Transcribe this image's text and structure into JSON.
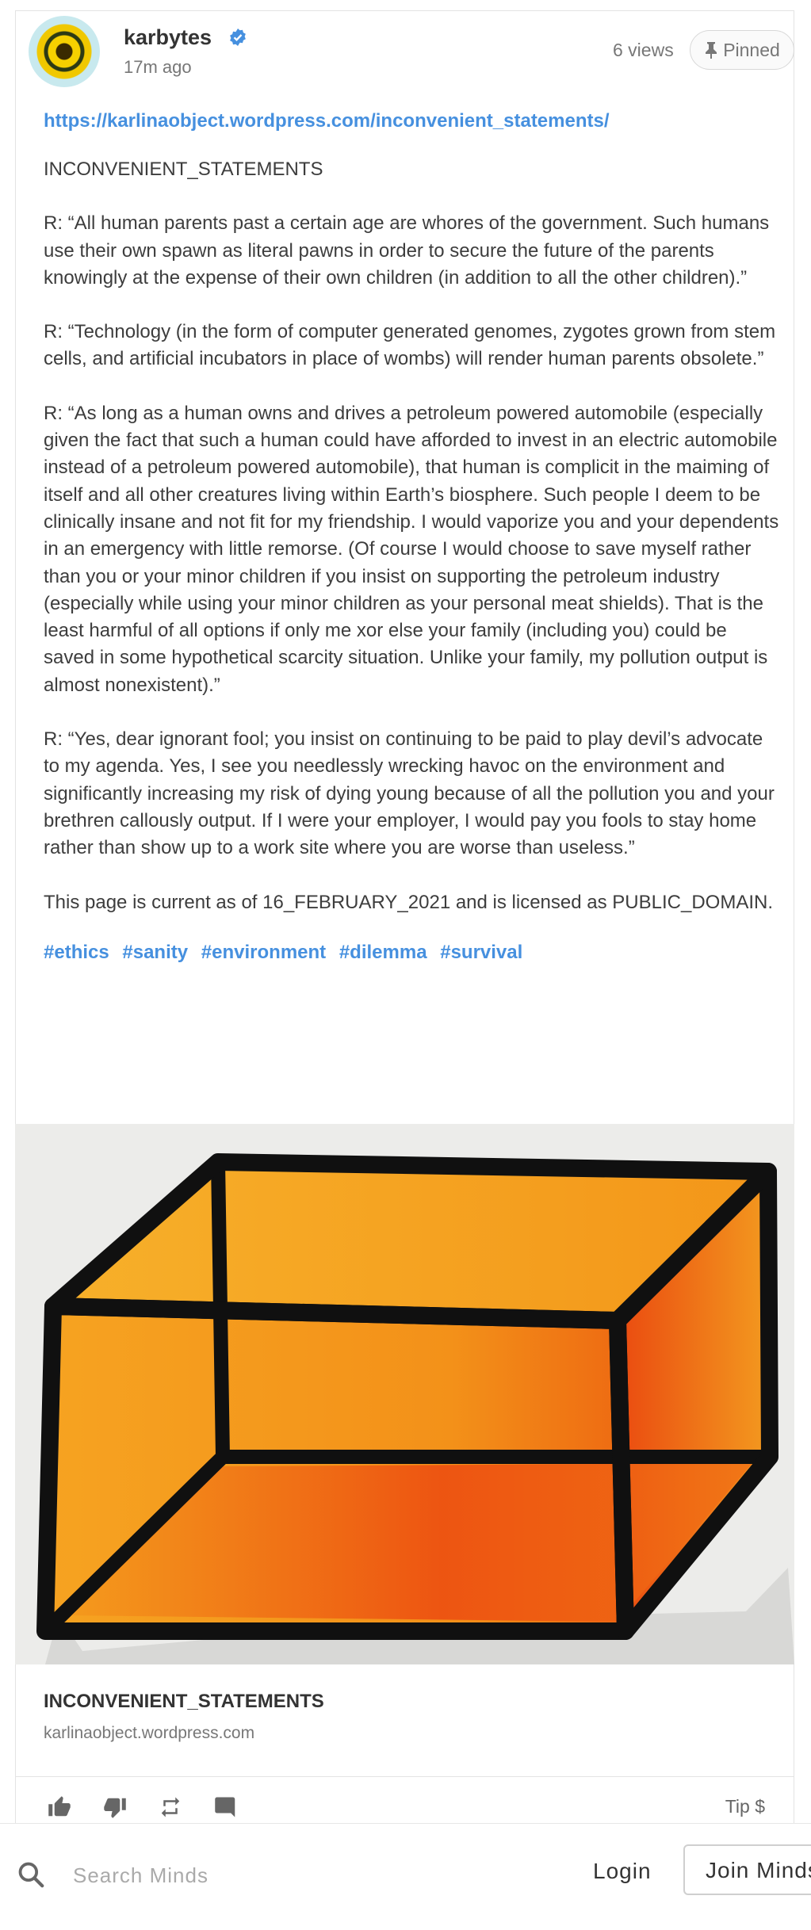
{
  "post": {
    "author": "karbytes",
    "time": "17m ago",
    "views": "6 views",
    "pinned_label": "Pinned",
    "link": "https://karlinaobject.wordpress.com/inconvenient_statements/",
    "paragraphs": [
      "INCONVENIENT_STATEMENTS",
      "R: “All human parents past a certain age are whores of the government. Such humans use their own spawn as literal pawns in order to secure the future of the parents knowingly at the expense of their own children (in addition to all the other children).”",
      "R: “Technology (in the form of computer generated genomes, zygotes grown from stem cells, and artificial incubators in place of wombs) will render human parents obsolete.”",
      "R: “As long as a human owns and drives a petroleum powered automobile (especially given the fact that such a human could have afforded to invest in an electric automobile instead of a petroleum powered automobile), that human is complicit in the maiming of itself and all other creatures living within Earth’s biosphere. Such people I deem to be clinically insane and not fit for my friendship. I would vaporize you and your dependents in an emergency with little remorse. (Of course I would choose to save myself rather than you or your minor children if you insist on supporting the petroleum industry (especially while using your minor children as your personal meat shields). That is the least harmful of all options if only me xor else your family (including you) could be saved in some hypothetical scarcity situation. Unlike your family, my pollution output is almost nonexistent).”",
      "R: “Yes, dear ignorant fool; you insist on continuing to be paid to play devil’s advocate to my agenda. Yes, I see you needlessly wrecking havoc on the environment and significantly increasing my risk of dying young because of all the pollution you and your brethren callously output. If I were your employer, I would pay you fools to stay home rather than show up to a work site where you are worse than useless.”",
      "This page is current as of 16_FEBRUARY_2021 and is licensed as PUBLIC_DOMAIN."
    ],
    "tags": [
      "#ethics",
      "#sanity",
      "#environment",
      "#dilemma",
      "#survival"
    ],
    "media_title": "INCONVENIENT_STATEMENTS",
    "media_domain": "karlinaobject.wordpress.com",
    "tip_label": "Tip $"
  },
  "bottombar": {
    "search_placeholder": "Search Minds",
    "login_label": "Login",
    "join_label": "Join Minds"
  },
  "colors": {
    "link": "#4690df",
    "verified": "#4690df",
    "box_orange": "#f59a1a",
    "box_red": "#e8400e"
  },
  "icons": {
    "verified": "verified-badge-icon",
    "pin": "pin-icon",
    "thumbs_up": "thumbs-up-icon",
    "thumbs_down": "thumbs-down-icon",
    "remind": "repeat-icon",
    "comment": "comment-icon",
    "search": "search-icon"
  }
}
